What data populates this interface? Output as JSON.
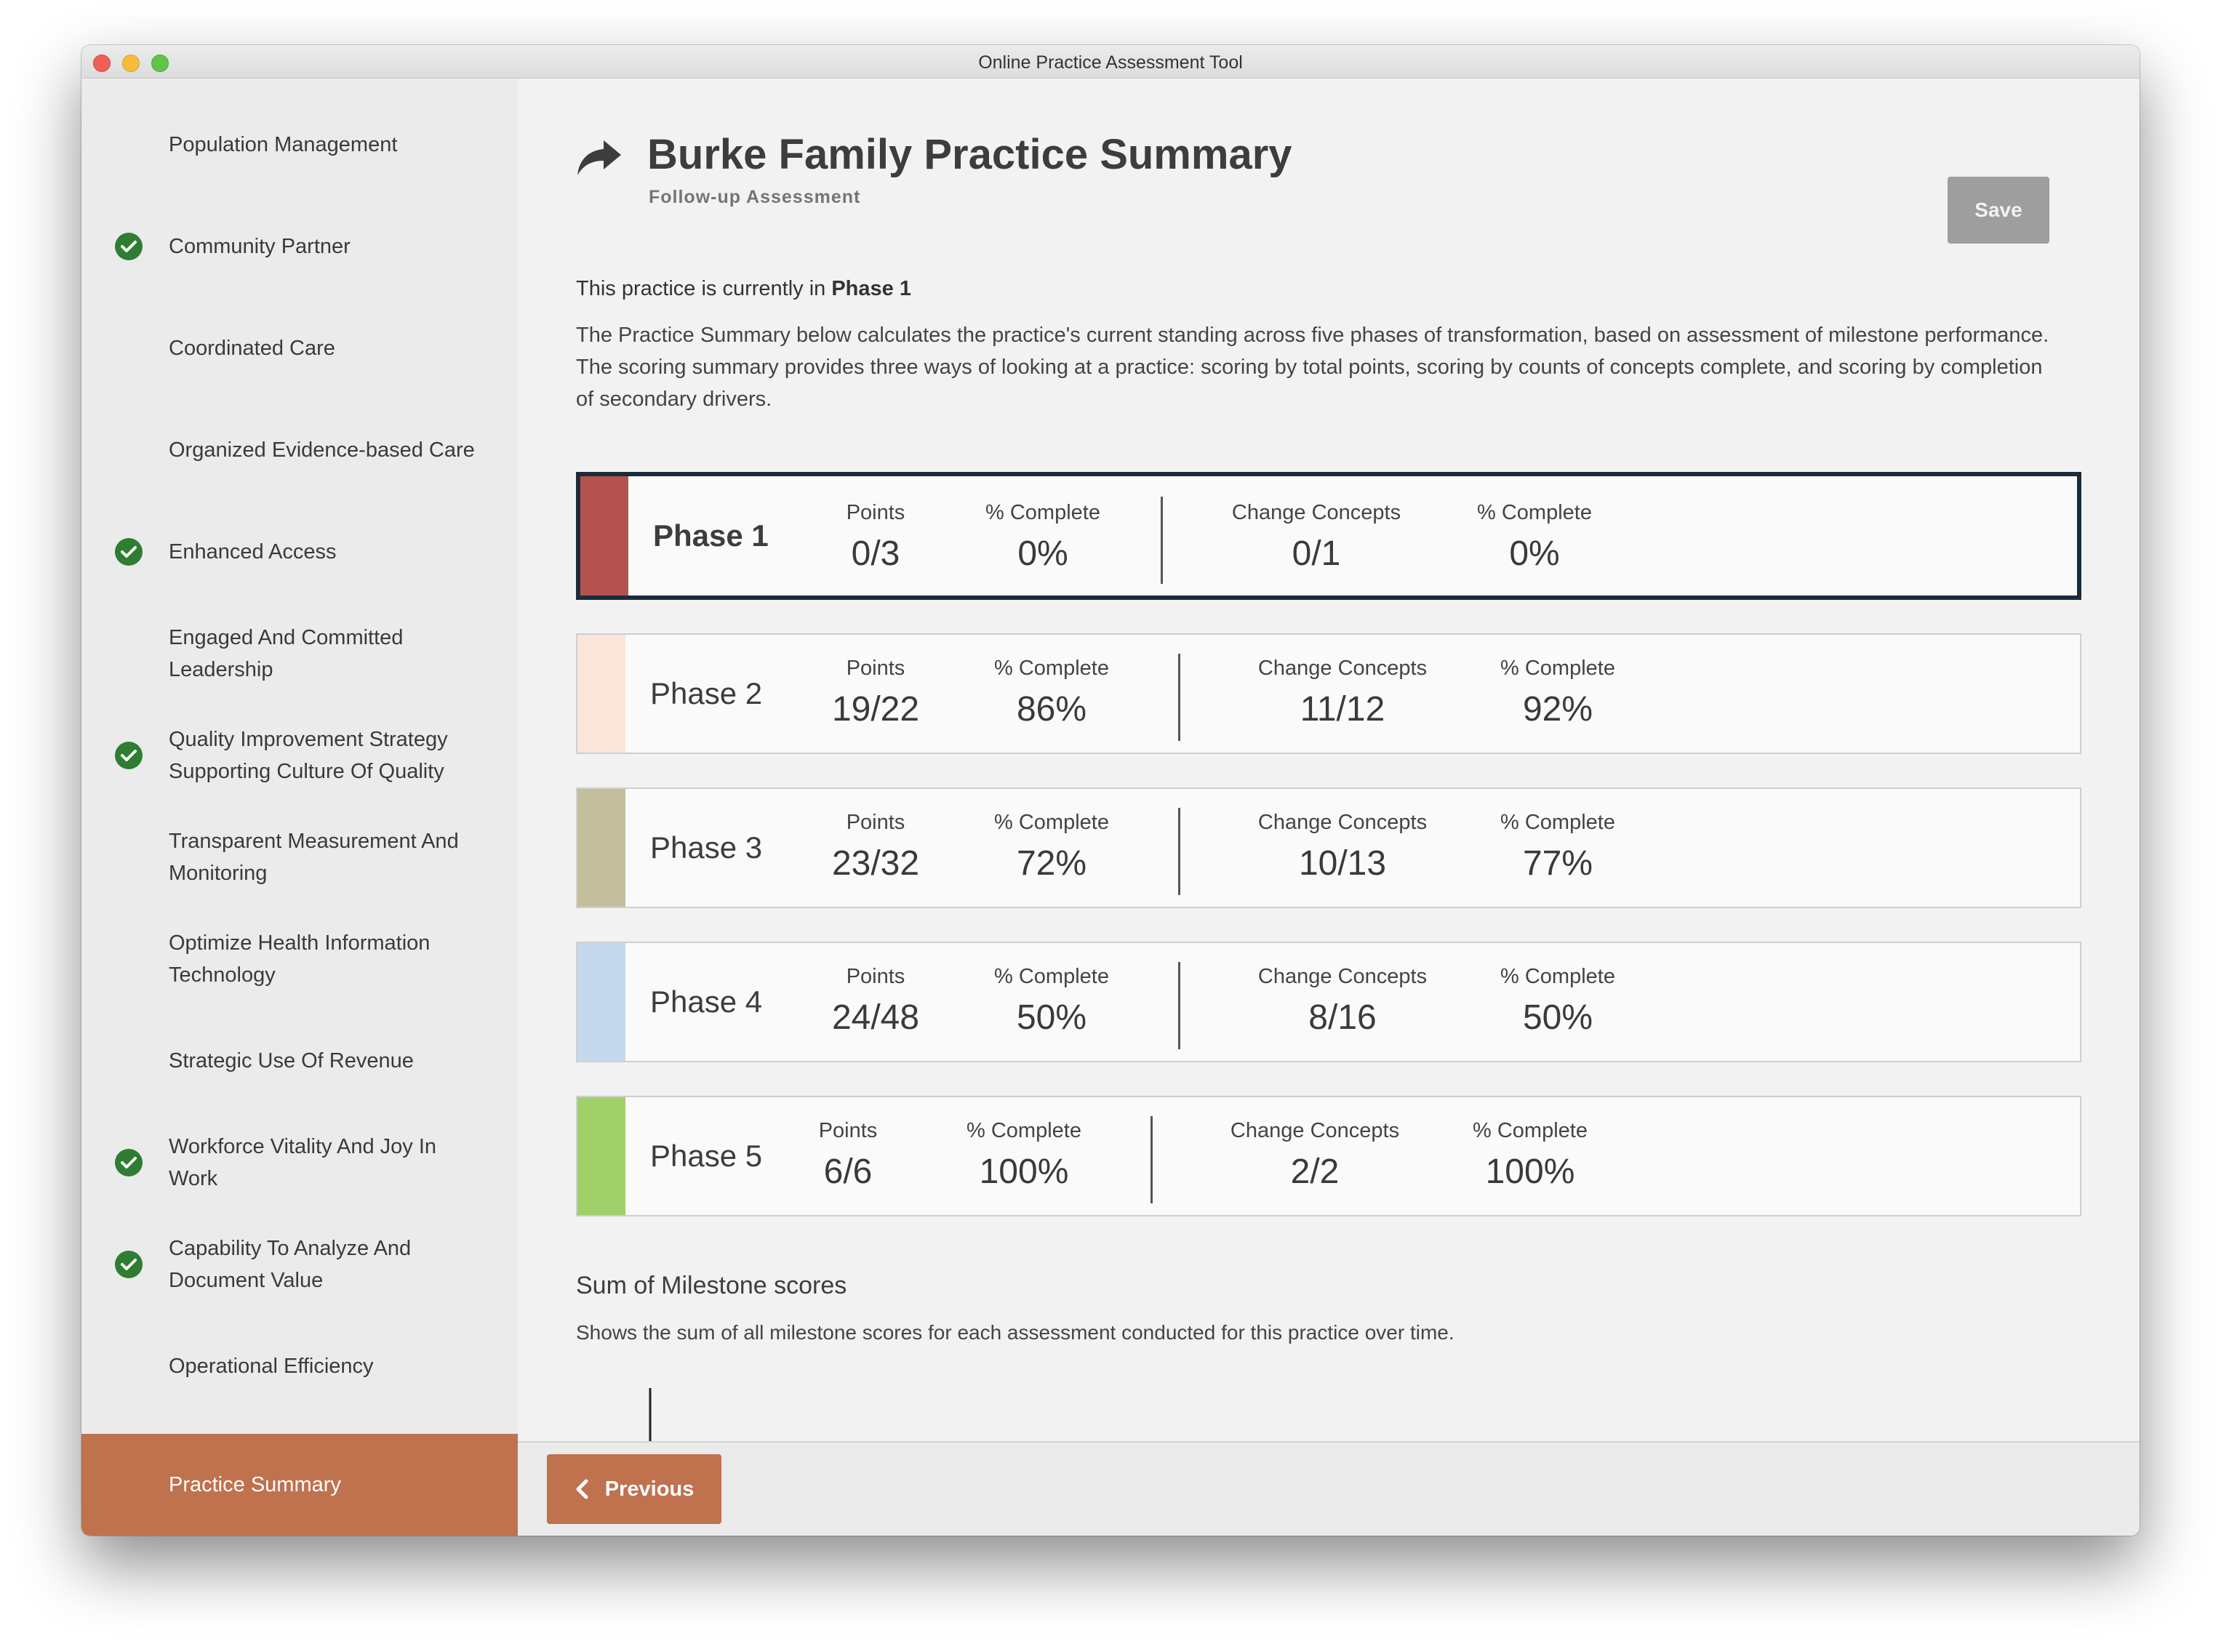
{
  "window": {
    "title": "Online Practice Assessment Tool"
  },
  "sidebar": {
    "items": [
      {
        "label": "Population Management",
        "checked": false
      },
      {
        "label": "Community Partner",
        "checked": true
      },
      {
        "label": "Coordinated Care",
        "checked": false
      },
      {
        "label": "Organized Evidence-based Care",
        "checked": false
      },
      {
        "label": "Enhanced Access",
        "checked": true
      },
      {
        "label": "Engaged And Committed Leadership",
        "checked": false
      },
      {
        "label": "Quality Improvement Strategy Supporting Culture Of Quality",
        "checked": true
      },
      {
        "label": "Transparent Measurement And Monitoring",
        "checked": false
      },
      {
        "label": "Optimize Health Information Technology",
        "checked": false
      },
      {
        "label": "Strategic Use Of Revenue",
        "checked": false
      },
      {
        "label": "Workforce Vitality And Joy In Work",
        "checked": true
      },
      {
        "label": "Capability To Analyze And Document Value",
        "checked": true
      },
      {
        "label": "Operational Efficiency",
        "checked": false
      },
      {
        "label": "Practice Summary",
        "checked": false,
        "active": true
      }
    ]
  },
  "header": {
    "icon": "share-forward-icon",
    "title": "Burke Family Practice Summary",
    "subtitle": "Follow-up Assessment",
    "save_label": "Save"
  },
  "current_phase": {
    "text": "This practice is currently in ",
    "phase": "Phase 1"
  },
  "intro": "The Practice Summary below calculates the practice's current standing across five phases of transformation, based on assessment of milestone performance. The scoring summary provides three ways of looking at a practice: scoring by total points, scoring by counts of concepts complete, and scoring by completion of secondary drivers.",
  "labels": {
    "points": "Points",
    "pct_complete": "% Complete",
    "change_concepts": "Change Concepts"
  },
  "phases": [
    {
      "name": "Phase 1",
      "points": "0/3",
      "points_pct": "0%",
      "concepts": "0/1",
      "concepts_pct": "0%",
      "color": "#b5524f",
      "current": true
    },
    {
      "name": "Phase 2",
      "points": "19/22",
      "points_pct": "86%",
      "concepts": "11/12",
      "concepts_pct": "92%",
      "color": "#f9e5da",
      "current": false
    },
    {
      "name": "Phase 3",
      "points": "23/32",
      "points_pct": "72%",
      "concepts": "10/13",
      "concepts_pct": "77%",
      "color": "#c3bf9c",
      "current": false
    },
    {
      "name": "Phase 4",
      "points": "24/48",
      "points_pct": "50%",
      "concepts": "8/16",
      "concepts_pct": "50%",
      "color": "#c6d8ee",
      "current": false
    },
    {
      "name": "Phase 5",
      "points": "6/6",
      "points_pct": "100%",
      "concepts": "2/2",
      "concepts_pct": "100%",
      "color": "#9fd06a",
      "current": false
    }
  ],
  "milestones": {
    "title": "Sum of Milestone scores",
    "description": "Shows the sum of all milestone scores for each assessment conducted for this practice over time.",
    "axis_tick": "80"
  },
  "footer": {
    "previous_label": "Previous"
  },
  "colors": {
    "accent": "#c0714e",
    "check": "#2e7d32",
    "current_border": "#1c2b3a",
    "save_disabled": "#9e9e9e"
  }
}
